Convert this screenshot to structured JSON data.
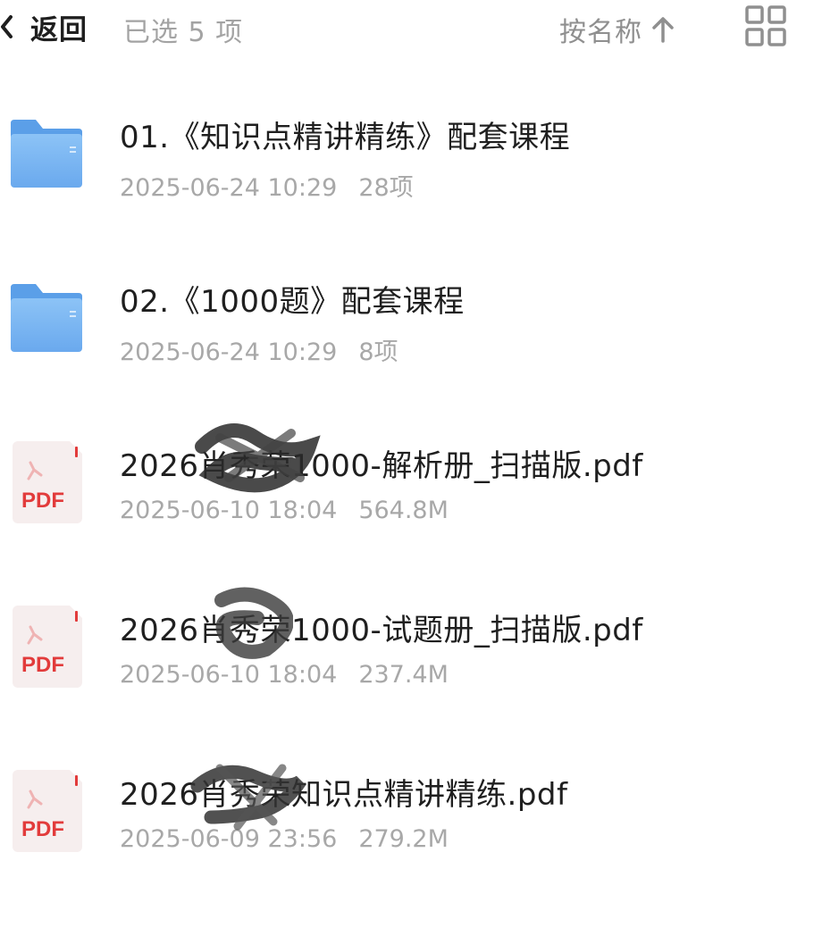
{
  "header": {
    "back_label": "返回",
    "selected_text": "已选 5 项",
    "sort_label": "按名称",
    "sort_direction": "ascending",
    "view_icon": "grid-icon"
  },
  "files": [
    {
      "type": "folder",
      "name": "01.《知识点精讲精练》配套课程",
      "date": "2025-06-24 10:29",
      "size": "28项",
      "icon": "folder-icon"
    },
    {
      "type": "folder",
      "name": "02.《1000题》配套课程",
      "date": "2025-06-24 10:29",
      "size": "8项",
      "icon": "folder-icon"
    },
    {
      "type": "pdf",
      "name": "2026肖秀荣1000-解析册_扫描版.pdf",
      "date": "2025-06-10 18:04",
      "size": "564.8M",
      "icon": "pdf-icon",
      "icon_label": "PDF"
    },
    {
      "type": "pdf",
      "name": "2026肖秀荣1000-试题册_扫描版.pdf",
      "date": "2025-06-10 18:04",
      "size": "237.4M",
      "icon": "pdf-icon",
      "icon_label": "PDF"
    },
    {
      "type": "pdf",
      "name": "2026肖秀荣知识点精讲精练.pdf",
      "date": "2025-06-09 23:56",
      "size": "279.2M",
      "icon": "pdf-icon",
      "icon_label": "PDF"
    }
  ],
  "colors": {
    "folder_blue": "#7ab6f3",
    "pdf_red": "#e23b3b",
    "text_primary": "#1f1f1f",
    "text_secondary": "#a8a8a8"
  }
}
